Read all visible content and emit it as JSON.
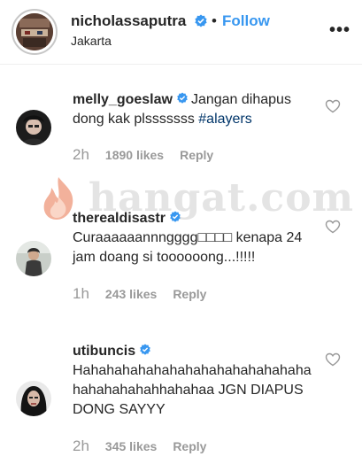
{
  "header": {
    "username": "nicholassaputra",
    "separator": "•",
    "follow_label": "Follow",
    "location": "Jakarta",
    "more_icon": "more-options-icon"
  },
  "watermark": {
    "text": "hangat.com"
  },
  "comments": [
    {
      "username": "melly_goeslaw",
      "verified": true,
      "text": "Jangan dihapus dong kak plsssssss ",
      "hashtag": "#alayers",
      "time": "2h",
      "likes": "1890 likes",
      "reply": "Reply"
    },
    {
      "username": "therealdisastr",
      "verified": true,
      "text": "Curaaaaaannngggg□□□□ kenapa 24 jam doang si toooooong...!!!!!",
      "time": "1h",
      "likes": "243 likes",
      "reply": "Reply"
    },
    {
      "username": "utibuncis",
      "verified": true,
      "text": "Hahahahahahahahahahahahahahahahahahahahahhahahaa JGN DIAPUS DONG SAYYY",
      "time": "2h",
      "likes": "345 likes",
      "reply": "Reply"
    }
  ],
  "colors": {
    "link_blue": "#3897f0",
    "meta_gray": "#999999",
    "text": "#262626"
  }
}
